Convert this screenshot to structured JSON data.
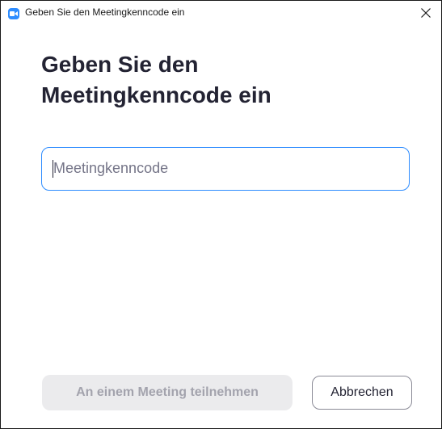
{
  "window": {
    "title": "Geben Sie den Meetingkenncode ein",
    "app_icon": "zoom-camera-icon",
    "close_icon": "close-icon"
  },
  "main": {
    "heading_line1": "Geben Sie den",
    "heading_line2": "Meetingkenncode ein",
    "passcode_input": {
      "value": "",
      "placeholder": "Meetingkenncode"
    }
  },
  "actions": {
    "join_label": "An einem Meeting teilnehmen",
    "cancel_label": "Abbrechen"
  },
  "colors": {
    "accent": "#2d8cff",
    "disabled_bg": "#ebebed",
    "disabled_text": "#a3a3ad",
    "heading_text": "#232333"
  }
}
